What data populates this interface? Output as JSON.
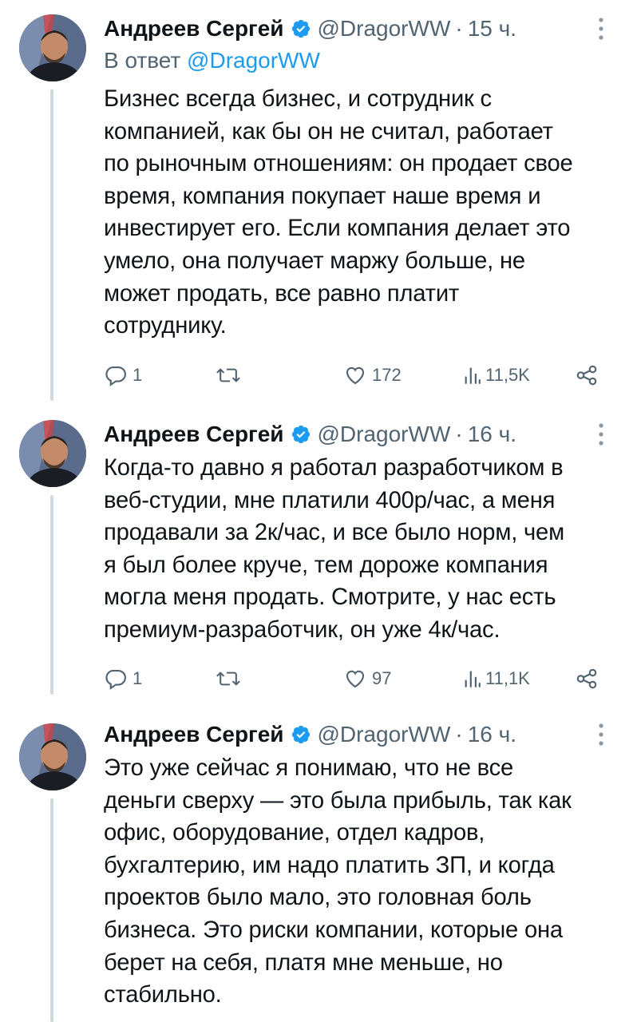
{
  "tweets": [
    {
      "author_name": "Андреев Сергей",
      "handle": "@DragorWW",
      "separator": "·",
      "time": "15 ч.",
      "reply_prefix": "В ответ",
      "reply_mention": "@DragorWW",
      "lines": [
        "Бизнес всегда бизнес, и сотрудник с",
        "компанией, как бы он не считал, работает",
        "по рыночным отношениям: он продает свое",
        "время, компания покупает наше время и",
        "инвестирует его. Если компания делает это",
        "умело, она получает маржу больше, не",
        "может продать, все равно платит",
        "сотруднику."
      ],
      "replies": "1",
      "retweets": "",
      "likes": "172",
      "views": "11,5K"
    },
    {
      "author_name": "Андреев Сергей",
      "handle": "@DragorWW",
      "separator": "·",
      "time": "16 ч.",
      "lines": [
        "Когда-то давно я работал разработчиком в",
        "веб-студии, мне платили 400р/час, а меня",
        "продавали за 2к/час, и все было норм, чем",
        "я был более круче, тем дороже компания",
        "могла меня продать. Смотрите, у нас есть",
        "премиум-разработчик, он уже 4к/час."
      ],
      "replies": "1",
      "retweets": "",
      "likes": "97",
      "views": "11,1K"
    },
    {
      "author_name": "Андреев Сергей",
      "handle": "@DragorWW",
      "separator": "·",
      "time": "16 ч.",
      "lines": [
        "Это уже сейчас я понимаю, что не все",
        "деньги сверху — это была прибыль, так как",
        "офис, оборудование, отдел кадров,",
        "бухгалтерию, им надо платить ЗП, и когда",
        "проектов было мало, это головная боль",
        "бизнеса. Это риски компании, которые она",
        "берет на себя, платя мне меньше, но",
        "стабильно."
      ]
    }
  ],
  "colors": {
    "text": "#0f1419",
    "secondary": "#536471",
    "link": "#1d9bf0",
    "verified": "#1d9bf0",
    "thread_line": "#cfd9de"
  },
  "icons": {
    "verified": "verified-badge-icon",
    "more": "more-vertical-icon",
    "reply": "reply-icon",
    "retweet": "retweet-icon",
    "like": "heart-icon",
    "views": "views-icon",
    "share": "share-icon"
  }
}
